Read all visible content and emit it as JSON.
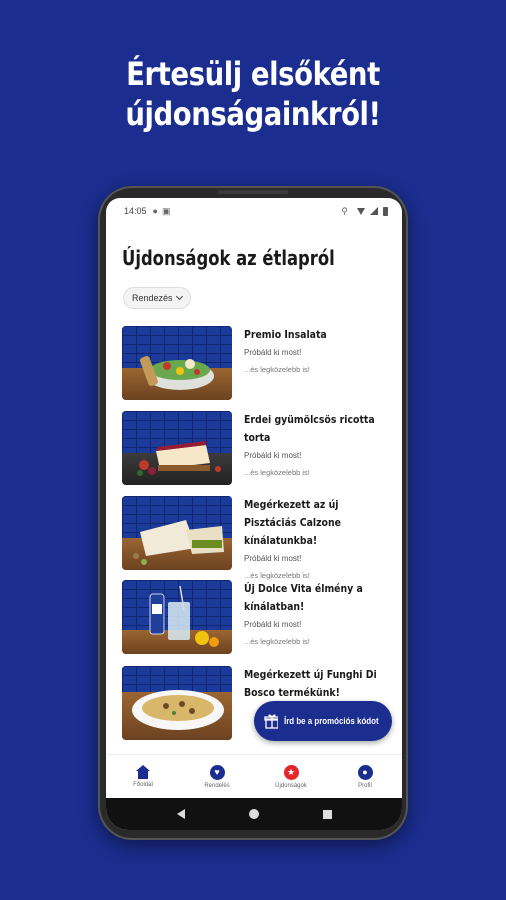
{
  "promo": {
    "headline_line1": "Értesülj elsőként",
    "headline_line2": "újdonságainkról!"
  },
  "status_bar": {
    "time": "14:05"
  },
  "page": {
    "title": "Újdonságok az étlapról",
    "sort_label": "Rendezés"
  },
  "items": [
    {
      "title": "Premio Insalata",
      "subtitle": "Próbáld ki most!",
      "note": "...és legközelebb is!",
      "image": "salad-bowl"
    },
    {
      "title": "Erdei gyümölcsös ricotta torta",
      "subtitle": "Próbáld ki most!",
      "note": "...és legközelebb is!",
      "image": "berry-cheesecake"
    },
    {
      "title": "Megérkezett az új Pisztáciás Calzone kínálatunkba!",
      "subtitle": "Próbáld ki most!",
      "note": "...és legközelebb is!",
      "image": "calzone"
    },
    {
      "title": "Új Dolce Vita élmény a kínálatban!",
      "subtitle": "Próbáld ki most!",
      "note": "...és legközelebb is!",
      "image": "drink-glass"
    },
    {
      "title": "Megérkezett új Funghi Di Bosco termékünk!",
      "subtitle": "",
      "note": "",
      "image": "pasta-plate"
    }
  ],
  "fab": {
    "label": "Írd be a promóciós kódot",
    "icon": "gift-icon"
  },
  "tabs": [
    {
      "label": "Főoldal",
      "icon": "home-icon"
    },
    {
      "label": "Rendelés",
      "icon": "order-icon"
    },
    {
      "label": "Újdonságok",
      "icon": "star-icon",
      "active": true
    },
    {
      "label": "Profil",
      "icon": "profile-icon"
    }
  ],
  "colors": {
    "brand_blue": "#1b2d8f",
    "accent_red": "#e52628"
  }
}
